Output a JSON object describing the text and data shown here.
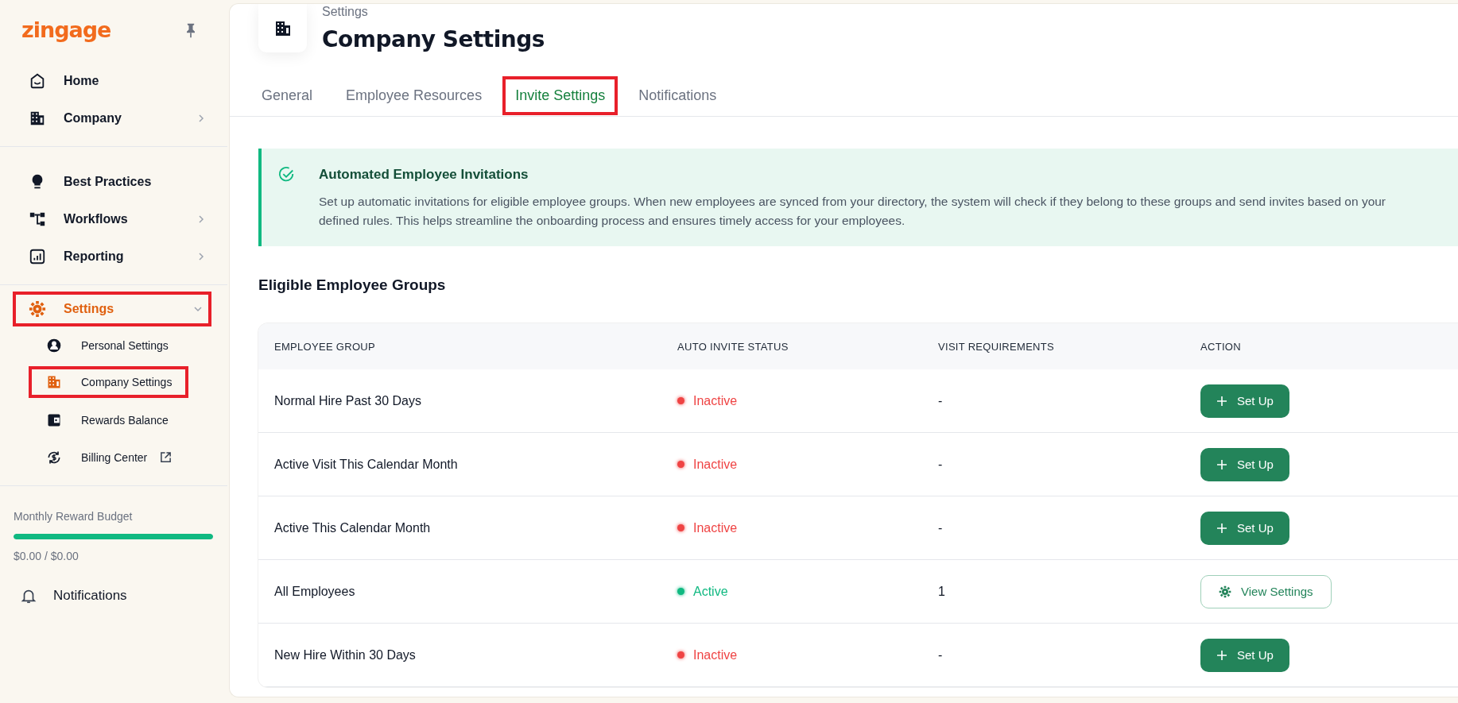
{
  "sidebar": {
    "logo": "zingage",
    "pinned": true,
    "groups": [
      [
        {
          "label": "Home",
          "kind": "link",
          "selected": false,
          "highlighted": false
        },
        {
          "label": "Company",
          "kind": "menu",
          "selected": false,
          "highlighted": false
        }
      ],
      [
        {
          "label": "Best Practices",
          "kind": "link",
          "selected": false,
          "highlighted": false
        },
        {
          "label": "Workflows",
          "kind": "menu",
          "selected": false,
          "highlighted": false
        },
        {
          "label": "Reporting",
          "kind": "menu",
          "selected": false,
          "highlighted": false
        }
      ],
      [
        {
          "label": "Settings",
          "kind": "menu",
          "expanded": true,
          "selected": true,
          "highlighted": true,
          "children": [
            {
              "label": "Personal Settings",
              "kind": "link",
              "selected": false,
              "highlighted": false
            },
            {
              "label": "Company Settings",
              "kind": "link",
              "selected": true,
              "highlighted": true
            },
            {
              "label": "Rewards Balance",
              "kind": "link",
              "selected": false,
              "highlighted": false
            },
            {
              "label": "Billing Center",
              "kind": "external",
              "selected": false,
              "highlighted": false
            }
          ]
        }
      ]
    ],
    "budget": {
      "label": "Monthly Reward Budget",
      "level": 1,
      "amount": "$0.00 / $0.00"
    },
    "notifications": "Notifications"
  },
  "header": {
    "breadcrumb": "Settings",
    "title": "Company Settings"
  },
  "tabs": [
    {
      "label": "General",
      "selected": false,
      "highlighted": false
    },
    {
      "label": "Employee Resources",
      "selected": false,
      "highlighted": false
    },
    {
      "label": "Invite Settings",
      "selected": true,
      "highlighted": true
    },
    {
      "label": "Notifications",
      "selected": false,
      "highlighted": false
    }
  ],
  "banner": {
    "title": "Automated Employee Invitations",
    "text": "Set up automatic invitations for eligible employee groups. When new employees are synced from your directory, the system will check if they belong to these groups and send invites based on your defined rules. This helps streamline the onboarding process and ensures timely access for your employees."
  },
  "section_title": "Eligible Employee Groups",
  "table": {
    "columns": [
      "EMPLOYEE GROUP",
      "AUTO INVITE STATUS",
      "VISIT REQUIREMENTS",
      "ACTION"
    ],
    "rows": [
      {
        "group": "Normal Hire Past 30 Days",
        "status": "Inactive",
        "color": "#ef4444",
        "visits": "-",
        "action": {
          "kind": "setup",
          "label": "Set Up"
        }
      },
      {
        "group": "Active Visit This Calendar Month",
        "status": "Inactive",
        "color": "#ef4444",
        "visits": "-",
        "action": {
          "kind": "setup",
          "label": "Set Up"
        }
      },
      {
        "group": "Active This Calendar Month",
        "status": "Inactive",
        "color": "#ef4444",
        "visits": "-",
        "action": {
          "kind": "setup",
          "label": "Set Up"
        }
      },
      {
        "group": "All Employees",
        "status": "Active",
        "color": "#10b981",
        "visits": "1",
        "action": {
          "kind": "view",
          "label": "View Settings"
        }
      },
      {
        "group": "New Hire Within 30 Days",
        "status": "Inactive",
        "color": "#ef4444",
        "visits": "-",
        "action": {
          "kind": "setup",
          "label": "Set Up"
        }
      }
    ]
  }
}
